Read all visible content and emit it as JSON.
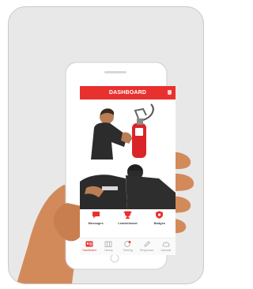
{
  "app": {
    "title": "DASHBOARD",
    "accent_color": "#e8312f"
  },
  "quick_actions": [
    {
      "label": "Messages",
      "icon": "chat-bubble-icon"
    },
    {
      "label": "Leaderboard",
      "icon": "trophy-icon"
    },
    {
      "label": "Badges",
      "icon": "badge-shield-icon"
    }
  ],
  "tabs": [
    {
      "label": "Dashboard",
      "icon": "id-card-icon",
      "active": true
    },
    {
      "label": "Library",
      "icon": "library-icon",
      "active": false
    },
    {
      "label": "Training",
      "icon": "training-icon",
      "active": false,
      "notification": true
    },
    {
      "label": "Responses",
      "icon": "pen-icon",
      "active": false
    },
    {
      "label": "Uploads",
      "icon": "cloud-upload-icon",
      "active": false
    }
  ]
}
